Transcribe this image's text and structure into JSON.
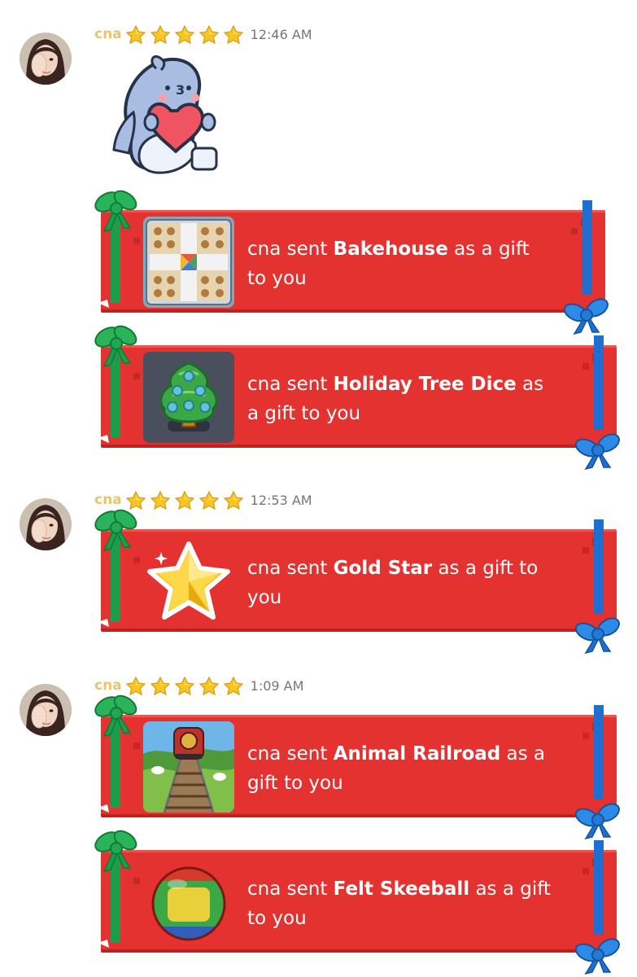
{
  "messages": [
    {
      "username": "cna",
      "star_count": 5,
      "time": "12:46 AM",
      "gifts": [
        {
          "prefix": "cna sent ",
          "item": "Bakehouse",
          "suffix": " as a gift to you",
          "icon": "bakehouse-board-icon"
        },
        {
          "prefix": "cna sent ",
          "item": "Holiday Tree Dice",
          "suffix": " as a gift to you",
          "icon": "holiday-tree-dice-icon"
        }
      ]
    },
    {
      "username": "cna",
      "star_count": 5,
      "time": "12:53 AM",
      "gifts": [
        {
          "prefix": "cna sent ",
          "item": "Gold Star",
          "suffix": " as a gift to you",
          "icon": "gold-star-icon"
        }
      ]
    },
    {
      "username": "cna",
      "star_count": 5,
      "time": "1:09 AM",
      "gifts": [
        {
          "prefix": "cna sent ",
          "item": "Animal Railroad",
          "suffix": " as a gift to you",
          "icon": "animal-railroad-icon"
        },
        {
          "prefix": "cna sent ",
          "item": "Felt Skeeball",
          "suffix": " as a gift to you",
          "icon": "felt-skeeball-icon"
        }
      ]
    }
  ],
  "colors": {
    "username": "#e9c46a",
    "timestamp": "#72767d",
    "gift_card": "#e3322f",
    "ribbon_left": "#1b9e4b",
    "ribbon_right": "#1e6fd0"
  },
  "sticker": "shark-holding-heart-sticker"
}
